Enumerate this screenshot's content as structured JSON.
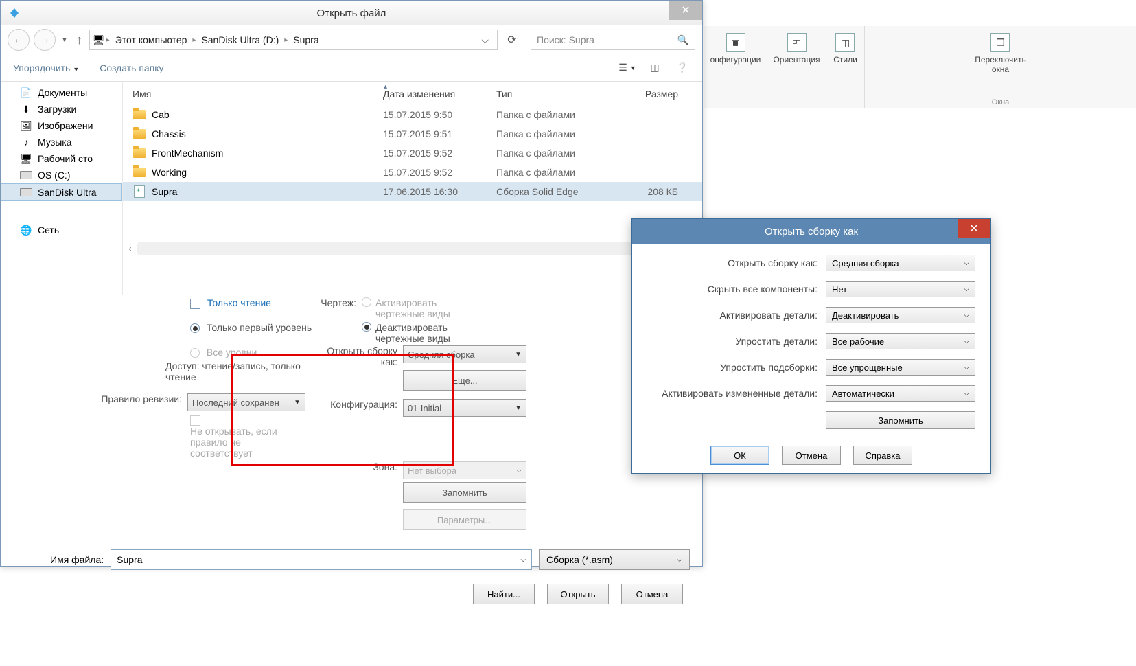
{
  "ribbon": {
    "items": [
      {
        "label": "онфигурации"
      },
      {
        "label": "Ориентация"
      },
      {
        "label": "Стили"
      },
      {
        "label": "Переключить\nокна"
      }
    ],
    "caption": "Окна"
  },
  "dialog": {
    "title": "Открыть файл",
    "breadcrumb": {
      "items": [
        "Этот компьютер",
        "SanDisk Ultra (D:)",
        "Supra"
      ]
    },
    "search_placeholder": "Поиск: Supra",
    "tools": {
      "organize": "Упорядочить",
      "new_folder": "Создать папку"
    },
    "sidebar": {
      "items": [
        {
          "label": "Документы"
        },
        {
          "label": "Загрузки"
        },
        {
          "label": "Изображени"
        },
        {
          "label": "Музыка"
        },
        {
          "label": "Рабочий сто"
        },
        {
          "label": "OS (C:)"
        },
        {
          "label": "SanDisk Ultra"
        }
      ],
      "network": "Сеть"
    },
    "columns": {
      "name": "Имя",
      "date": "Дата изменения",
      "type": "Тип",
      "size": "Размер"
    },
    "files": [
      {
        "name": "Cab",
        "date": "15.07.2015 9:50",
        "type": "Папка с файлами",
        "size": "",
        "kind": "folder"
      },
      {
        "name": "Chassis",
        "date": "15.07.2015 9:51",
        "type": "Папка с файлами",
        "size": "",
        "kind": "folder"
      },
      {
        "name": "FrontMechanism",
        "date": "15.07.2015 9:52",
        "type": "Папка с файлами",
        "size": "",
        "kind": "folder"
      },
      {
        "name": "Working",
        "date": "15.07.2015 9:52",
        "type": "Папка с файлами",
        "size": "",
        "kind": "folder"
      },
      {
        "name": "Supra",
        "date": "17.06.2015 16:30",
        "type": "Сборка Solid Edge",
        "size": "208 КБ",
        "kind": "file"
      }
    ],
    "options": {
      "readonly": "Только чтение",
      "first_level": "Только первый уровень",
      "all_levels": "Все уровни",
      "access": "Доступ: чтение/запись, только чтение",
      "rev_rule": "Правило ревизии:",
      "rev_rule_val": "Последний сохранен",
      "no_open": "Не открывать, если правило не соответствует",
      "drawing": "Чертеж:",
      "activate_views": "Активировать чертежные виды",
      "deactivate_views": "Деактивировать чертежные виды",
      "open_asm": "Открыть сборку как:",
      "open_asm_val": "Средняя сборка",
      "more": "Еще...",
      "config": "Конфигурация:",
      "config_val": "01-Initial",
      "zone": "Зона:",
      "zone_val": "Нет выбора",
      "remember": "Запомнить",
      "params": "Параметры..."
    },
    "file_label": "Имя файла:",
    "file_value": "Supra",
    "filter": "Сборка (*.asm)",
    "buttons": {
      "find": "Найти...",
      "open": "Открыть",
      "cancel": "Отмена"
    }
  },
  "dialog2": {
    "title": "Открыть сборку как",
    "rows": [
      {
        "label": "Открыть сборку как:",
        "value": "Средняя сборка"
      },
      {
        "label": "Скрыть все компоненты:",
        "value": "Нет"
      },
      {
        "label": "Активировать детали:",
        "value": "Деактивировать"
      },
      {
        "label": "Упростить детали:",
        "value": "Все рабочие"
      },
      {
        "label": "Упростить подсборки:",
        "value": "Все упрощенные"
      },
      {
        "label": "Активировать измененные детали:",
        "value": "Автоматически"
      }
    ],
    "remember": "Запомнить",
    "buttons": {
      "ok": "ОК",
      "cancel": "Отмена",
      "help": "Справка"
    }
  }
}
